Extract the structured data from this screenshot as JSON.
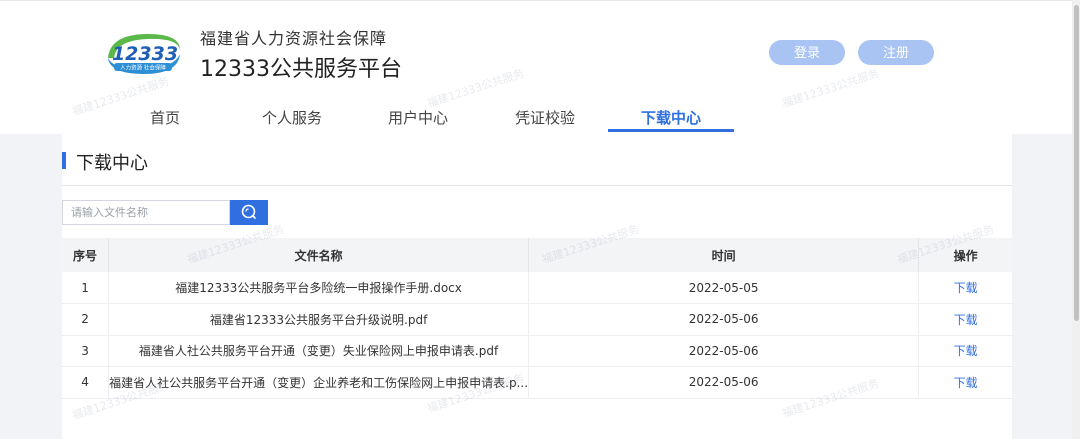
{
  "header": {
    "org_name": "福建省人力资源社会保障",
    "platform_name": "12333公共服务平台",
    "logo_text": "12333",
    "logo_subtext": "人力资源 社会保障",
    "login_label": "登录",
    "register_label": "注册"
  },
  "nav": {
    "items": [
      {
        "label": "首页"
      },
      {
        "label": "个人服务"
      },
      {
        "label": "用户中心"
      },
      {
        "label": "凭证校验"
      },
      {
        "label": "下载中心"
      }
    ],
    "active": "下载中心"
  },
  "section": {
    "title": "下载中心"
  },
  "search": {
    "placeholder": "请输入文件名称"
  },
  "table": {
    "headers": {
      "seq": "序号",
      "name": "文件名称",
      "time": "时间",
      "op": "操作"
    },
    "rows": [
      {
        "seq": "1",
        "name": "福建12333公共服务平台多险统一申报操作手册.docx",
        "time": "2022-05-05",
        "op": "下载"
      },
      {
        "seq": "2",
        "name": "福建省12333公共服务平台升级说明.pdf",
        "time": "2022-05-06",
        "op": "下载"
      },
      {
        "seq": "3",
        "name": "福建省人社公共服务平台开通（变更）失业保险网上申报申请表.pdf",
        "time": "2022-05-06",
        "op": "下载"
      },
      {
        "seq": "4",
        "name": "福建省人社公共服务平台开通（变更）企业养老和工伤保险网上申报申请表.p...",
        "time": "2022-05-06",
        "op": "下载"
      }
    ]
  },
  "watermark_text": "福建12333公共服务",
  "colors": {
    "accent": "#2f6fe0",
    "pill": "#a9c3f3"
  }
}
